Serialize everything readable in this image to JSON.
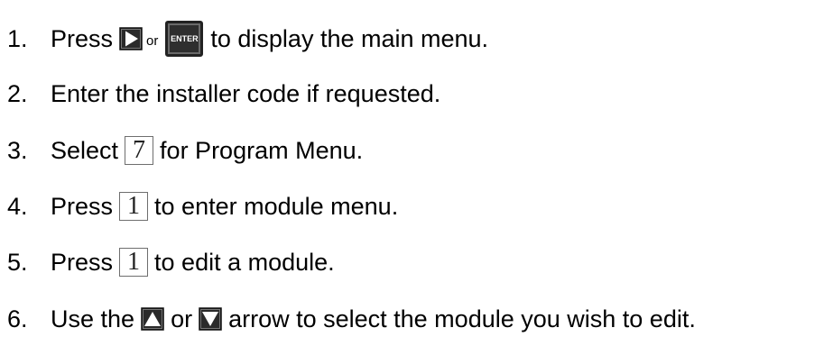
{
  "steps": [
    {
      "num": "1.",
      "before": "Press",
      "or": "or",
      "enter_label": "ENTER",
      "after": "to display the main menu."
    },
    {
      "num": "2.",
      "text": "Enter the installer code if requested."
    },
    {
      "num": "3.",
      "before": "Select",
      "key": "7",
      "after": "for Program Menu."
    },
    {
      "num": "4.",
      "before": "Press",
      "key": "1",
      "after": "to enter module menu."
    },
    {
      "num": "5.",
      "before": "Press",
      "key": "1",
      "after": "to edit a module."
    },
    {
      "num": "6.",
      "before": "Use the",
      "or": "or",
      "after": "arrow to select the module you wish to edit."
    }
  ],
  "icons": {
    "right_arrow": "right-arrow-key-icon",
    "enter": "enter-key-icon",
    "up_arrow": "up-arrow-key-icon",
    "down_arrow": "down-arrow-key-icon"
  }
}
